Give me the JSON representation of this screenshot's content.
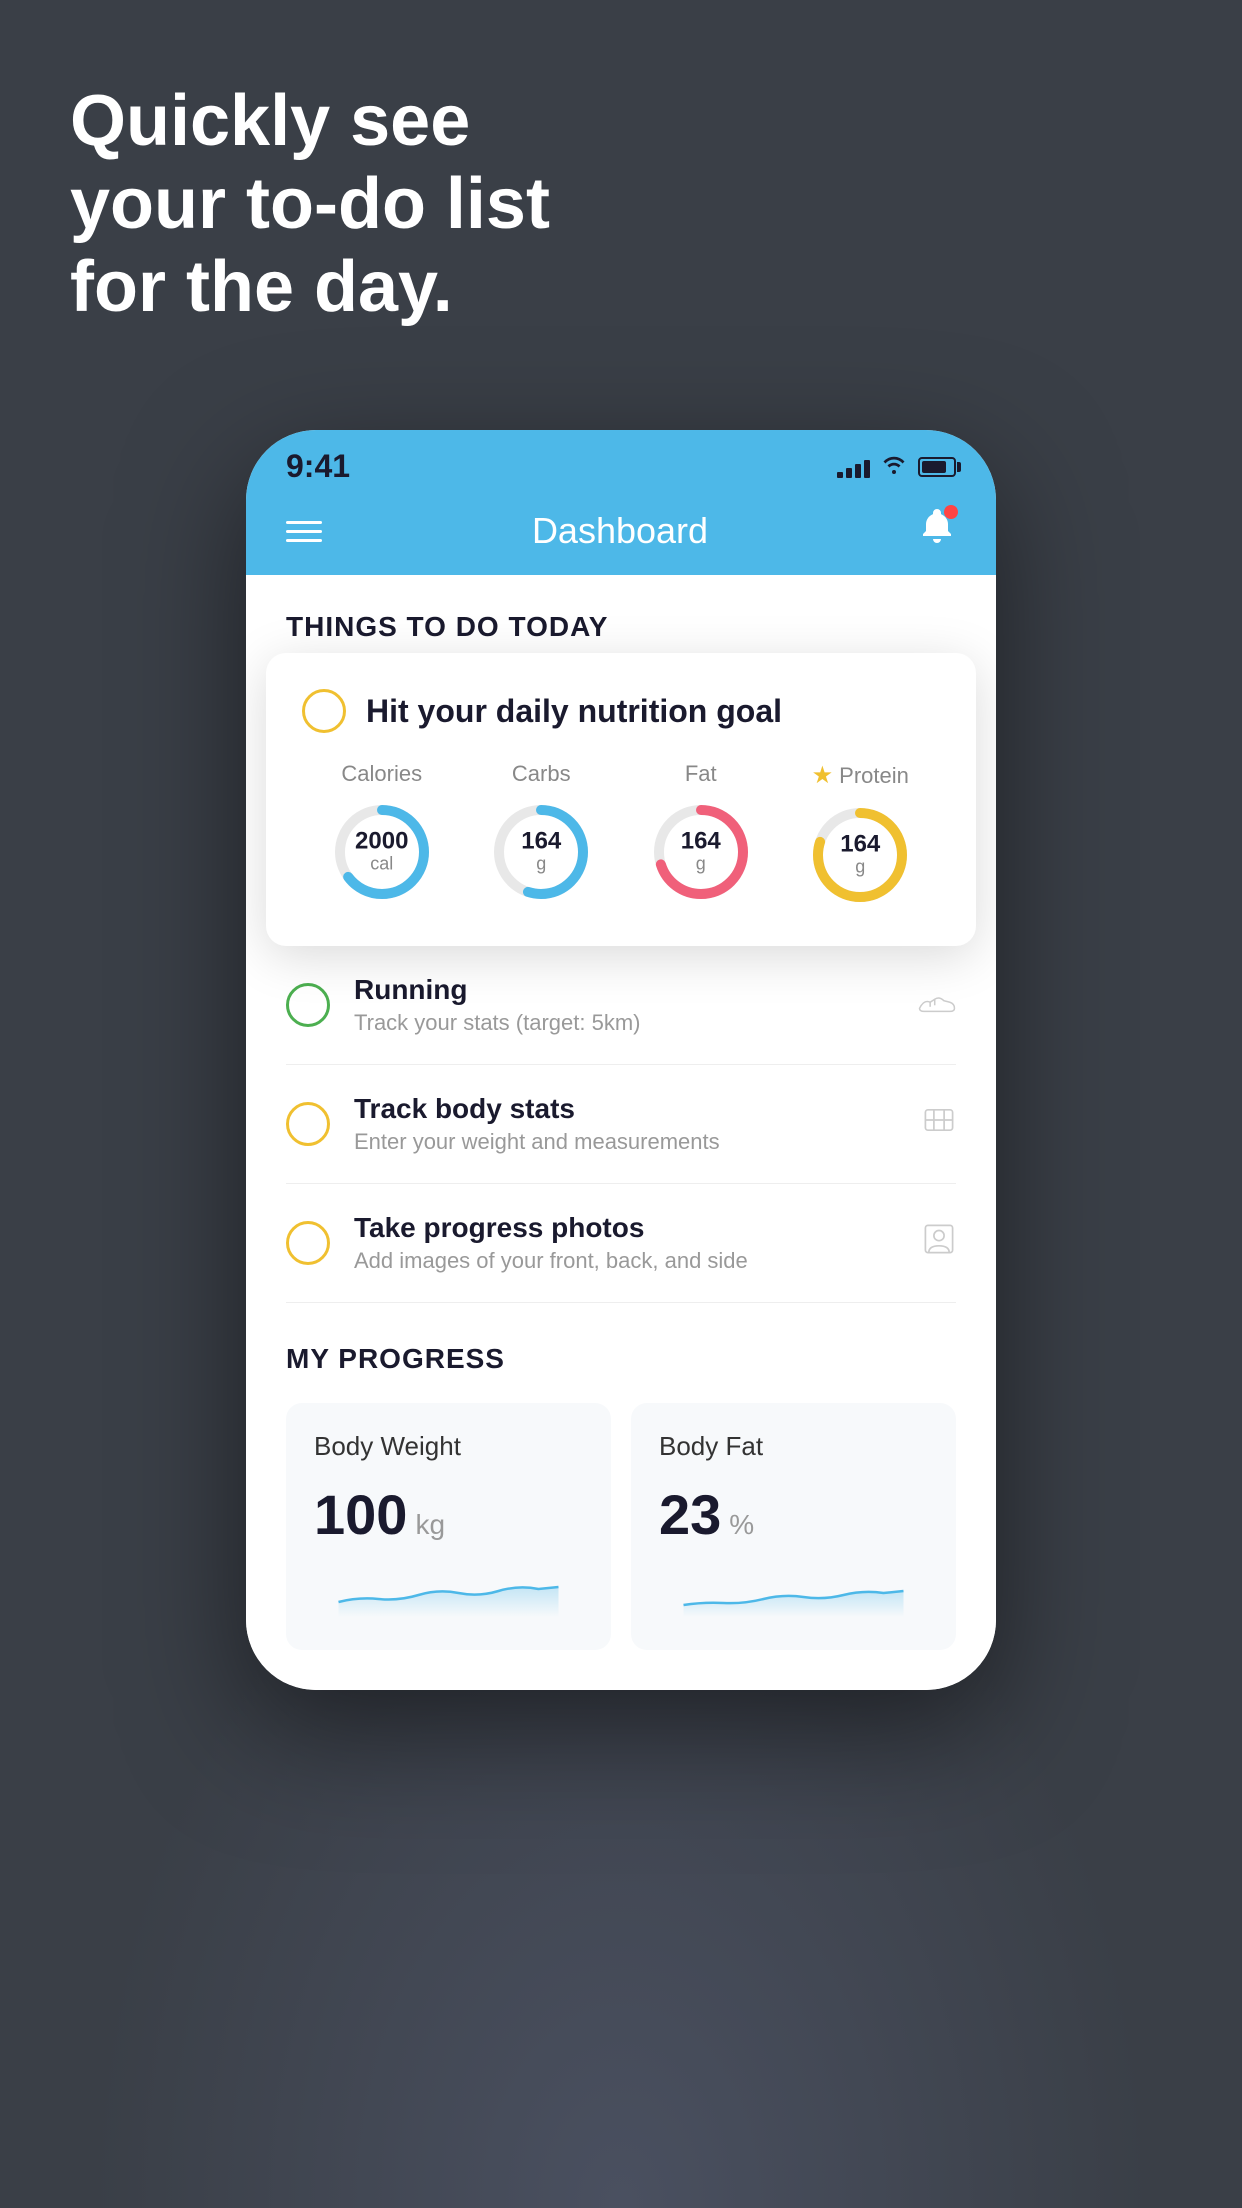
{
  "background": {
    "color": "#3a3f47"
  },
  "headline": {
    "line1": "Quickly see",
    "line2": "your to-do list",
    "line3": "for the day."
  },
  "phone": {
    "status_bar": {
      "time": "9:41",
      "signal_bars": [
        6,
        10,
        14,
        18
      ],
      "wifi": "wifi",
      "battery": 80
    },
    "nav_bar": {
      "title": "Dashboard",
      "hamburger_label": "menu",
      "bell_label": "notifications",
      "has_notification": true
    },
    "things_to_do": {
      "section_title": "THINGS TO DO TODAY",
      "nutrition_card": {
        "checkbox_state": "unchecked",
        "title": "Hit your daily nutrition goal",
        "macros": [
          {
            "label": "Calories",
            "value": "2000",
            "unit": "cal",
            "color": "#4db8e8",
            "star": false,
            "progress": 0.65
          },
          {
            "label": "Carbs",
            "value": "164",
            "unit": "g",
            "color": "#4db8e8",
            "star": false,
            "progress": 0.55
          },
          {
            "label": "Fat",
            "value": "164",
            "unit": "g",
            "color": "#f0607a",
            "star": false,
            "progress": 0.7
          },
          {
            "label": "Protein",
            "value": "164",
            "unit": "g",
            "color": "#f0c030",
            "star": true,
            "progress": 0.8
          }
        ]
      },
      "todo_items": [
        {
          "id": "running",
          "title": "Running",
          "subtitle": "Track your stats (target: 5km)",
          "check_color": "green",
          "icon": "shoe"
        },
        {
          "id": "body-stats",
          "title": "Track body stats",
          "subtitle": "Enter your weight and measurements",
          "check_color": "yellow",
          "icon": "scale"
        },
        {
          "id": "photos",
          "title": "Take progress photos",
          "subtitle": "Add images of your front, back, and side",
          "check_color": "yellow",
          "icon": "portrait"
        }
      ]
    },
    "progress": {
      "section_title": "MY PROGRESS",
      "cards": [
        {
          "id": "body-weight",
          "title": "Body Weight",
          "value": "100",
          "unit": "kg"
        },
        {
          "id": "body-fat",
          "title": "Body Fat",
          "value": "23",
          "unit": "%"
        }
      ]
    }
  }
}
